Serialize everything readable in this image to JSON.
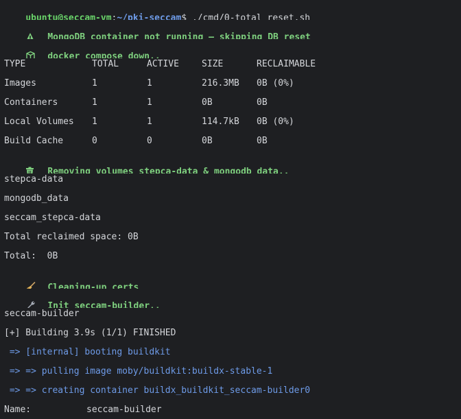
{
  "prompt": {
    "user_host": "ubuntu@seccam-vm",
    "sep": ":",
    "path": "~/pki-seccam",
    "symbol": "$",
    "command": " ./cmd/0-total_reset.sh"
  },
  "status_lines": {
    "mongo_warning": "MongoDB container not running — skipping DB reset",
    "compose_down": "docker compose down..",
    "removing_volumes": "Removing volumes stepca-data & mongodb_data..",
    "cleaning_certs": "Cleaning-up certs",
    "init_builder": "Init seccam-builder.."
  },
  "docker_df": {
    "headers": [
      "TYPE",
      "TOTAL",
      "ACTIVE",
      "SIZE",
      "RECLAIMABLE"
    ],
    "rows": [
      [
        "Images",
        "1",
        "1",
        "216.3MB",
        "0B (0%)"
      ],
      [
        "Containers",
        "1",
        "1",
        "0B",
        "0B"
      ],
      [
        "Local Volumes",
        "1",
        "1",
        "114.7kB",
        "0B (0%)"
      ],
      [
        "Build Cache",
        "0",
        "0",
        "0B",
        "0B"
      ]
    ]
  },
  "volume_lines": [
    "stepca-data",
    "mongodb_data",
    "seccam_stepca-data"
  ],
  "reclaimed": "Total reclaimed space: 0B",
  "total": "Total:  0B",
  "builder_name_line": "seccam-builder",
  "building_line": "[+] Building 3.9s (1/1) FINISHED",
  "buildkit_steps": [
    " => [internal] booting buildkit",
    " => => pulling image moby/buildkit:buildx-stable-1",
    " => => creating container buildx_buildkit_seccam-builder0"
  ],
  "name_field": {
    "label": "Name:",
    "value": "seccam-builder"
  },
  "colors": {
    "background": "#1e1f22",
    "text": "#d4d6da",
    "green": "#7fd17f",
    "blue": "#6e9be8"
  },
  "icons": [
    "warning-icon",
    "package-icon",
    "trash-icon",
    "broom-icon",
    "wrench-icon"
  ]
}
